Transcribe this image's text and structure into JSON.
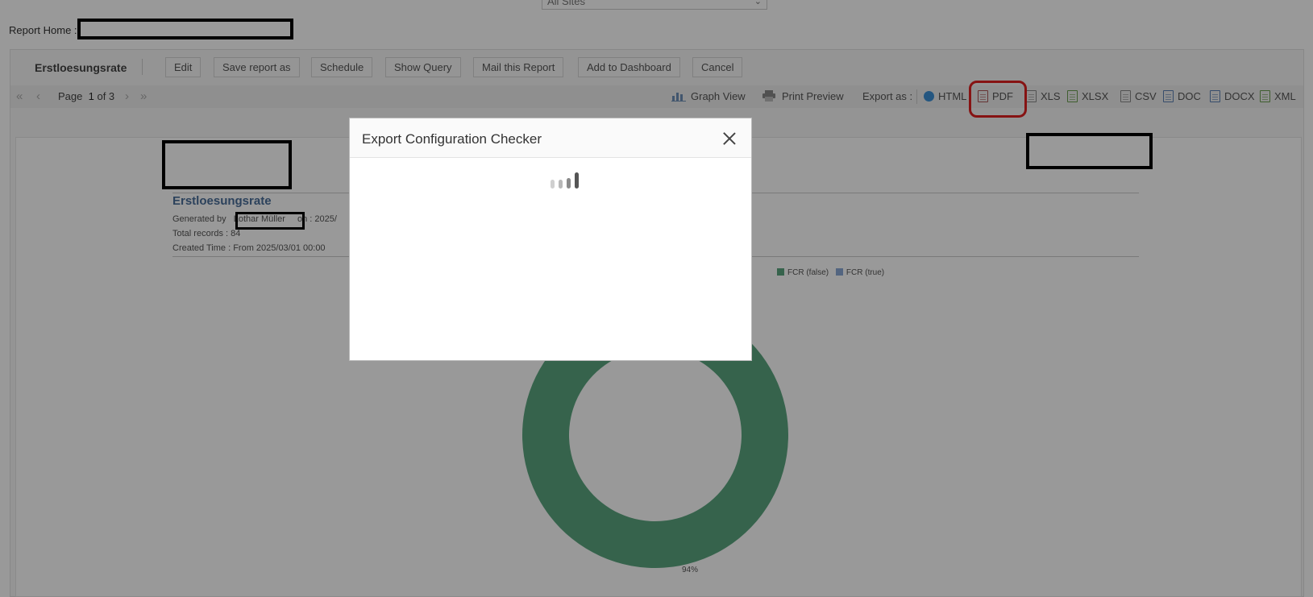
{
  "site_selector": {
    "value": "All Sites"
  },
  "breadcrumb": {
    "label": "Report Home :"
  },
  "toolbar": {
    "report_name": "Erstloesungsrate",
    "buttons": [
      "Edit",
      "Save report as",
      "Schedule",
      "Show Query",
      "Mail this Report",
      "Add to Dashboard",
      "Cancel"
    ]
  },
  "pager": {
    "prefix": "Page",
    "current": "1",
    "of_text": "of 3"
  },
  "view_tools": {
    "graph_view": "Graph View",
    "print_preview": "Print Preview"
  },
  "export": {
    "label": "Export as :",
    "formats": [
      "HTML",
      "PDF",
      "XLS",
      "XLSX",
      "CSV",
      "DOC",
      "DOCX",
      "XML"
    ]
  },
  "report": {
    "title": "Erstloesungsrate",
    "generated_by": "Generated by",
    "author": "Lothar Müller",
    "generated_on": "on : 2025/",
    "total_records": "Total records : 84",
    "created_time": "Created Time : From 2025/03/01 00:00"
  },
  "chart_data": {
    "type": "pie",
    "series": [
      {
        "name": "FCR (false)",
        "value": 94,
        "color": "#5aa67f"
      },
      {
        "name": "FCR (true)",
        "value": 6,
        "color": "#8aa8d6"
      }
    ],
    "labels": [
      "94%"
    ],
    "legend_position": "top-right"
  },
  "modal": {
    "title": "Export Configuration Checker",
    "close_icon": "close-icon",
    "loading_icon": "loading-spinner-icon"
  },
  "colors": {
    "highlight": "#e02020",
    "overlay": "rgba(0,0,0,0.40)"
  }
}
